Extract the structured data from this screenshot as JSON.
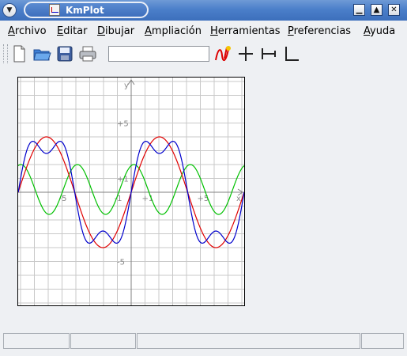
{
  "window": {
    "title": "KmPlot",
    "buttons": {
      "minimize": "▁",
      "maximize": "▲",
      "close": "✕"
    }
  },
  "menu": {
    "items": [
      {
        "label": "Archivo",
        "accel": "A",
        "rest": "rchivo"
      },
      {
        "label": "Editar",
        "accel": "E",
        "rest": "ditar"
      },
      {
        "label": "Dibujar",
        "accel": "D",
        "rest": "ibujar"
      },
      {
        "label": "Ampliación",
        "accel": "A",
        "rest": "mpliación"
      },
      {
        "label": "Herramientas",
        "accel": "H",
        "rest": "erramientas"
      },
      {
        "label": "Preferencias",
        "accel": "P",
        "rest": "referencias"
      },
      {
        "label": "Ayuda",
        "accel": "A",
        "rest": "yuda"
      }
    ]
  },
  "toolbar": {
    "tools": [
      "new-file-icon",
      "open-folder-icon",
      "save-icon",
      "print-icon"
    ],
    "function_input_value": "",
    "plot_tools": [
      "new-function-icon",
      "crosshair-icon",
      "h-axis-tool-icon",
      "l-axis-tool-icon"
    ]
  },
  "plot": {
    "axis_labels": {
      "x": "x",
      "y": "y"
    },
    "x_tick_labels": [
      "-5",
      "-1",
      "+1",
      "+5"
    ],
    "y_tick_labels": [
      "+5",
      "+1",
      "-5"
    ],
    "colors": {
      "red": "#e00000",
      "blue": "#0000cc",
      "green": "#00c000",
      "grid": "#c8c8c8",
      "axis": "#808080"
    }
  },
  "statusbar": {
    "cells": [
      "",
      "",
      "",
      ""
    ]
  }
}
